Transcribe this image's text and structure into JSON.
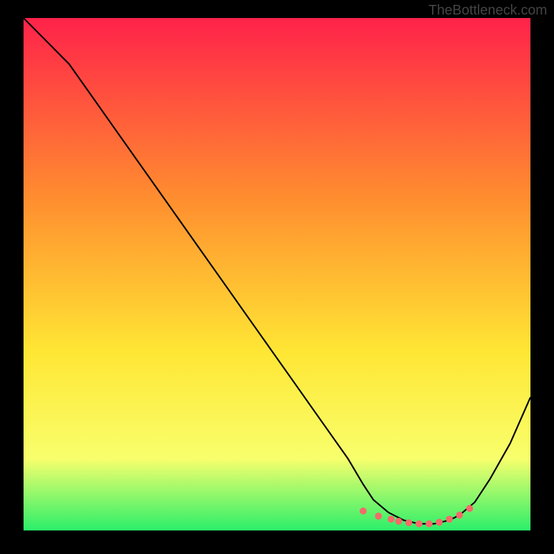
{
  "watermark": "TheBottleneck.com",
  "chart_data": {
    "type": "line",
    "title": "",
    "xlabel": "",
    "ylabel": "",
    "xlim": [
      0,
      100
    ],
    "ylim": [
      0,
      100
    ],
    "grid": false,
    "legend": false,
    "background_gradient": {
      "top": "#ff224a",
      "mid1": "#ff8d2f",
      "mid2": "#ffe634",
      "mid3": "#f8ff6c",
      "bottom": "#2bef6a"
    },
    "series": [
      {
        "name": "bottleneck-curve",
        "color": "#000000",
        "x": [
          0,
          4,
          9,
          14,
          19,
          24,
          29,
          34,
          39,
          44,
          49,
          54,
          59,
          64,
          67,
          69,
          72,
          75,
          78,
          81,
          84,
          86,
          89,
          92,
          96,
          100
        ],
        "y": [
          100,
          96,
          91,
          84,
          77,
          70,
          63,
          56,
          49,
          42,
          35,
          28,
          21,
          14,
          9,
          6,
          3.5,
          2,
          1.3,
          1.3,
          2,
          3,
          5.5,
          10,
          17,
          26
        ]
      }
    ],
    "markers": {
      "name": "optimal-range-dots",
      "color": "#f46a6a",
      "x": [
        67,
        70,
        72.5,
        74,
        76,
        78,
        80,
        82,
        84,
        86,
        88
      ],
      "y": [
        3.8,
        2.8,
        2.2,
        1.8,
        1.5,
        1.3,
        1.3,
        1.6,
        2.2,
        3.0,
        4.3
      ]
    }
  }
}
